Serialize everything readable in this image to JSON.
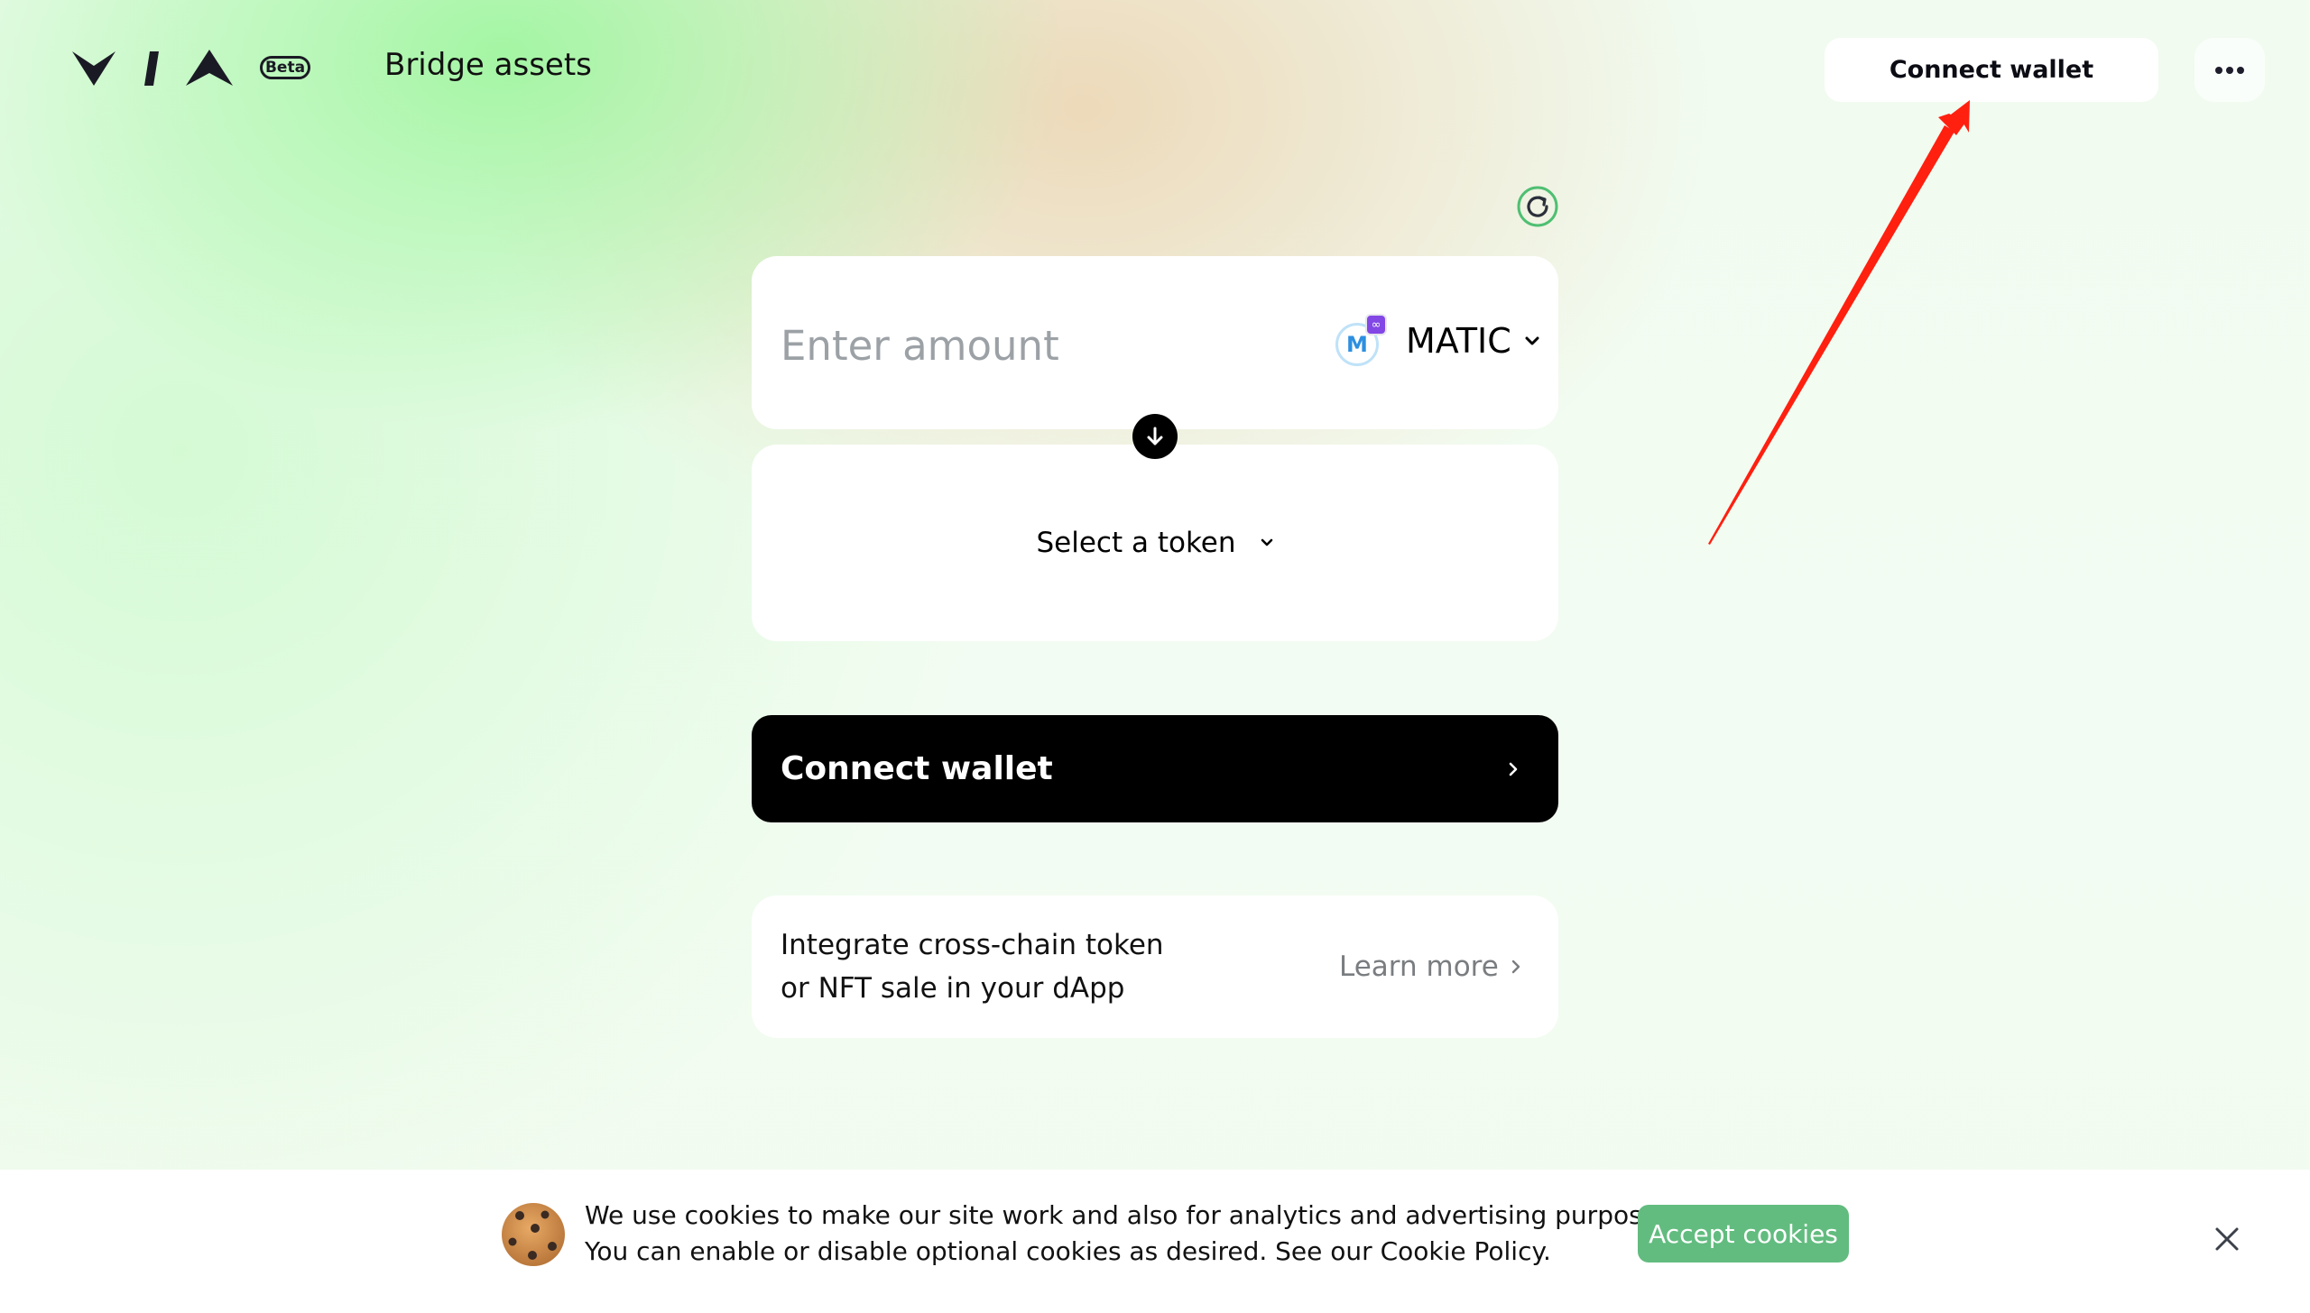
{
  "header": {
    "logo_text": "VIA",
    "beta_badge": "Beta",
    "title": "Bridge assets",
    "connect_wallet_label": "Connect wallet",
    "more_menu_icon": "more-horizontal-icon"
  },
  "swap": {
    "refresh_icon": "refresh-icon",
    "from": {
      "amount_placeholder": "Enter amount",
      "amount_value": "",
      "token_symbol": "MATIC",
      "token_icon": "matic-token-icon",
      "chain_badge_icon": "polygon-chain-icon"
    },
    "switch_icon": "arrow-down-icon",
    "to": {
      "select_label": "Select a token"
    },
    "primary_button_label": "Connect wallet"
  },
  "promo": {
    "line1": "Integrate cross-chain token",
    "line2": "or NFT sale in your dApp",
    "link_label": "Learn more"
  },
  "cookie_banner": {
    "line1": "We use cookies to make our site work and also for analytics and advertising purposes.",
    "line2": "You can enable or disable optional cookies as desired. See our Cookie Policy.",
    "accept_label": "Accept cookies",
    "close_icon": "close-icon"
  },
  "annotation": {
    "type": "red-arrow",
    "color": "#ff2010",
    "points_to": "header connect wallet button"
  },
  "colors": {
    "accent_green": "#62bc7f",
    "refresh_ring": "#4fbf72",
    "polygon_purple": "#8247e5",
    "button_black": "#000000"
  }
}
